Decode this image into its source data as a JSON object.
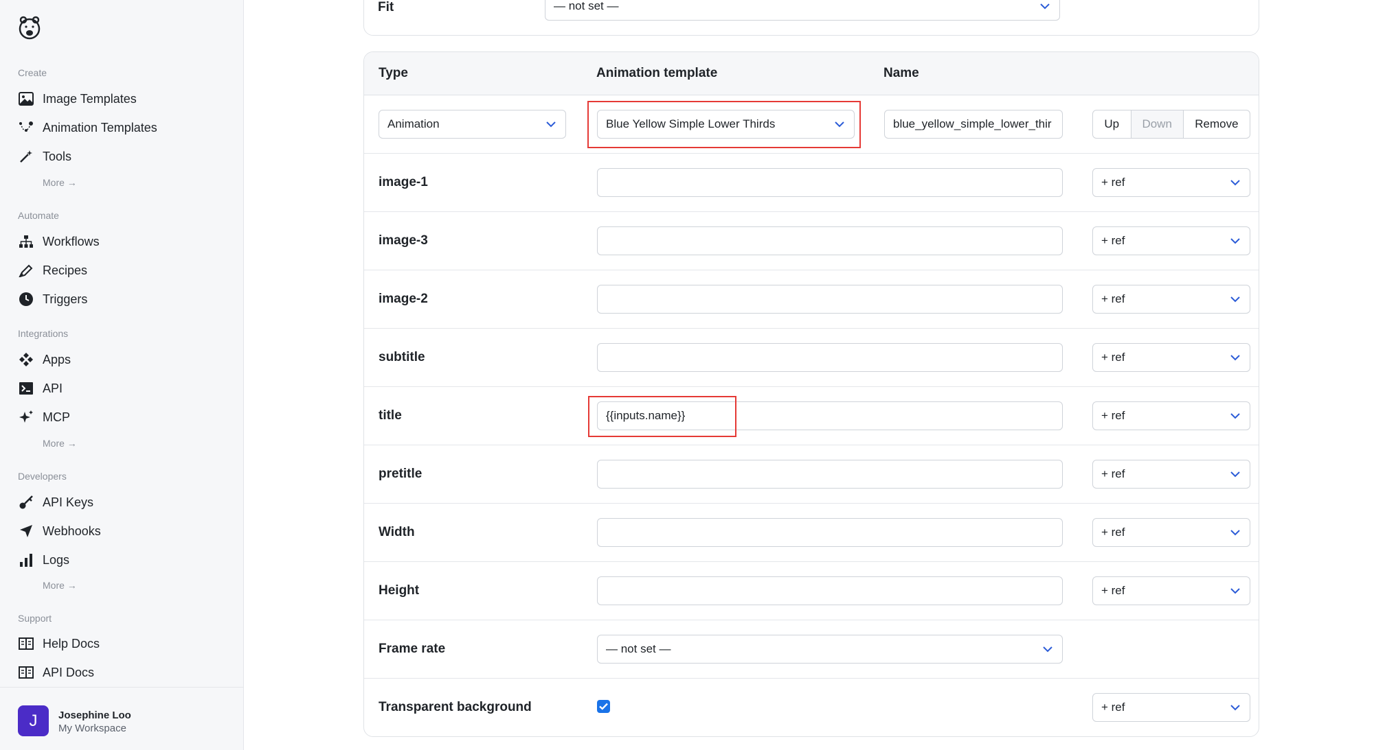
{
  "sidebar": {
    "sections": [
      {
        "label": "Create",
        "items": [
          {
            "label": "Image Templates",
            "icon": "image-icon"
          },
          {
            "label": "Animation Templates",
            "icon": "animation-icon"
          },
          {
            "label": "Tools",
            "icon": "wand-icon"
          }
        ],
        "more": "More →"
      },
      {
        "label": "Automate",
        "items": [
          {
            "label": "Workflows",
            "icon": "workflow-icon"
          },
          {
            "label": "Recipes",
            "icon": "pen-icon"
          },
          {
            "label": "Triggers",
            "icon": "clock-icon"
          }
        ]
      },
      {
        "label": "Integrations",
        "items": [
          {
            "label": "Apps",
            "icon": "apps-icon"
          },
          {
            "label": "API",
            "icon": "terminal-icon"
          },
          {
            "label": "MCP",
            "icon": "sparkle-icon"
          }
        ],
        "more": "More →"
      },
      {
        "label": "Developers",
        "items": [
          {
            "label": "API Keys",
            "icon": "key-icon"
          },
          {
            "label": "Webhooks",
            "icon": "send-icon"
          },
          {
            "label": "Logs",
            "icon": "bar-chart-icon"
          }
        ],
        "more": "More →"
      },
      {
        "label": "Support",
        "items": [
          {
            "label": "Help Docs",
            "icon": "book-icon"
          },
          {
            "label": "API Docs",
            "icon": "book-icon"
          }
        ]
      }
    ],
    "user": {
      "initial": "J",
      "name": "Josephine Loo",
      "workspace": "My Workspace"
    }
  },
  "fit": {
    "label": "Fit",
    "value": "— not set —"
  },
  "table": {
    "headers": {
      "type": "Type",
      "template": "Animation template",
      "name": "Name"
    },
    "first_row": {
      "type": "Animation",
      "template": "Blue Yellow Simple Lower Thirds",
      "name": "blue_yellow_simple_lower_thir",
      "buttons": {
        "up": "Up",
        "down": "Down",
        "remove": "Remove"
      }
    },
    "rows": [
      {
        "label": "image-1",
        "value": "",
        "ref": "+ ref"
      },
      {
        "label": "image-3",
        "value": "",
        "ref": "+ ref"
      },
      {
        "label": "image-2",
        "value": "",
        "ref": "+ ref"
      },
      {
        "label": "subtitle",
        "value": "",
        "ref": "+ ref"
      },
      {
        "label": "title",
        "value": "{{inputs.name}}",
        "ref": "+ ref"
      },
      {
        "label": "pretitle",
        "value": "",
        "ref": "+ ref"
      },
      {
        "label": "Width",
        "value": "",
        "ref": "+ ref"
      },
      {
        "label": "Height",
        "value": "",
        "ref": "+ ref"
      }
    ],
    "frame_rate": {
      "label": "Frame rate",
      "value": "— not set —"
    },
    "transparent": {
      "label": "Transparent background",
      "checked": true,
      "ref": "+ ref"
    }
  },
  "colors": {
    "accent": "#1a73e8",
    "highlight": "#e53935",
    "avatar": "#4b2cc7"
  }
}
